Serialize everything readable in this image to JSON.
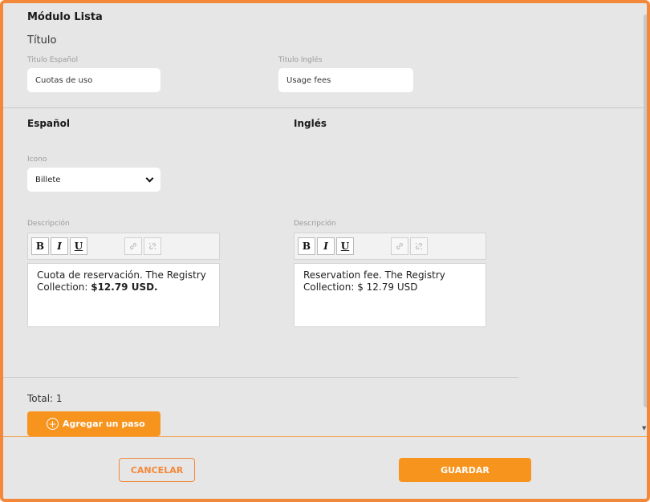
{
  "module": {
    "title": "Módulo Lista"
  },
  "title_section": {
    "heading": "Título",
    "spanish_label": "Titulo Español",
    "spanish_value": "Cuotas de uso",
    "english_label": "Titulo Inglés",
    "english_value": "Usage fees"
  },
  "columns": {
    "spanish": "Español",
    "english": "Inglés"
  },
  "icon_field": {
    "label": "Icono",
    "selected": "Billete"
  },
  "description": {
    "label": "Descripción",
    "toolbar": {
      "bold": "B",
      "italic": "I",
      "underline": "U",
      "link_icon": "link-icon",
      "unlink_icon": "unlink-icon"
    },
    "spanish": {
      "text": "Cuota de reservación. The Registry Collection: ",
      "bold_text": "$12.79 USD."
    },
    "english": {
      "text": "Reservation fee. The Registry Collection: $ 12.79 USD"
    }
  },
  "total": "Total: 1",
  "add_step_label": "Agregar un paso",
  "buttons": {
    "cancel": "CANCELAR",
    "save": "GUARDAR"
  },
  "colors": {
    "accent": "#f7941d",
    "frame": "#f4883a",
    "background": "#e6e6e6"
  }
}
